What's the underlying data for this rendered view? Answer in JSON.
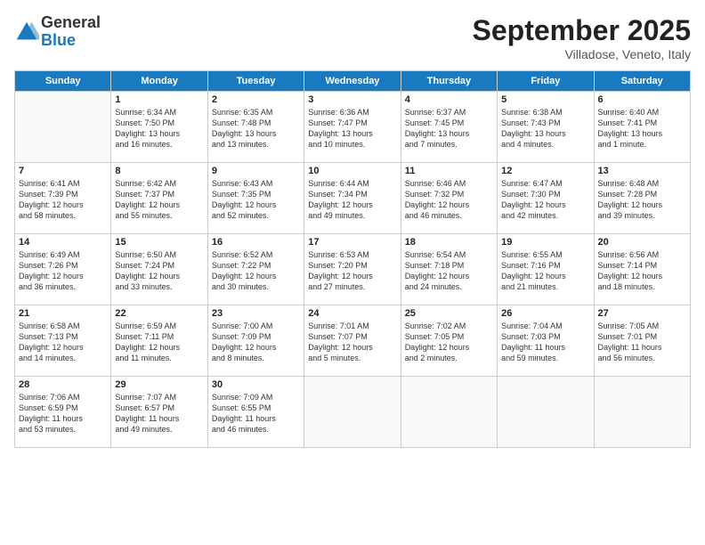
{
  "logo": {
    "general": "General",
    "blue": "Blue"
  },
  "header": {
    "month": "September 2025",
    "location": "Villadose, Veneto, Italy"
  },
  "weekdays": [
    "Sunday",
    "Monday",
    "Tuesday",
    "Wednesday",
    "Thursday",
    "Friday",
    "Saturday"
  ],
  "weeks": [
    [
      {
        "day": "",
        "info": ""
      },
      {
        "day": "1",
        "info": "Sunrise: 6:34 AM\nSunset: 7:50 PM\nDaylight: 13 hours\nand 16 minutes."
      },
      {
        "day": "2",
        "info": "Sunrise: 6:35 AM\nSunset: 7:48 PM\nDaylight: 13 hours\nand 13 minutes."
      },
      {
        "day": "3",
        "info": "Sunrise: 6:36 AM\nSunset: 7:47 PM\nDaylight: 13 hours\nand 10 minutes."
      },
      {
        "day": "4",
        "info": "Sunrise: 6:37 AM\nSunset: 7:45 PM\nDaylight: 13 hours\nand 7 minutes."
      },
      {
        "day": "5",
        "info": "Sunrise: 6:38 AM\nSunset: 7:43 PM\nDaylight: 13 hours\nand 4 minutes."
      },
      {
        "day": "6",
        "info": "Sunrise: 6:40 AM\nSunset: 7:41 PM\nDaylight: 13 hours\nand 1 minute."
      }
    ],
    [
      {
        "day": "7",
        "info": "Sunrise: 6:41 AM\nSunset: 7:39 PM\nDaylight: 12 hours\nand 58 minutes."
      },
      {
        "day": "8",
        "info": "Sunrise: 6:42 AM\nSunset: 7:37 PM\nDaylight: 12 hours\nand 55 minutes."
      },
      {
        "day": "9",
        "info": "Sunrise: 6:43 AM\nSunset: 7:35 PM\nDaylight: 12 hours\nand 52 minutes."
      },
      {
        "day": "10",
        "info": "Sunrise: 6:44 AM\nSunset: 7:34 PM\nDaylight: 12 hours\nand 49 minutes."
      },
      {
        "day": "11",
        "info": "Sunrise: 6:46 AM\nSunset: 7:32 PM\nDaylight: 12 hours\nand 46 minutes."
      },
      {
        "day": "12",
        "info": "Sunrise: 6:47 AM\nSunset: 7:30 PM\nDaylight: 12 hours\nand 42 minutes."
      },
      {
        "day": "13",
        "info": "Sunrise: 6:48 AM\nSunset: 7:28 PM\nDaylight: 12 hours\nand 39 minutes."
      }
    ],
    [
      {
        "day": "14",
        "info": "Sunrise: 6:49 AM\nSunset: 7:26 PM\nDaylight: 12 hours\nand 36 minutes."
      },
      {
        "day": "15",
        "info": "Sunrise: 6:50 AM\nSunset: 7:24 PM\nDaylight: 12 hours\nand 33 minutes."
      },
      {
        "day": "16",
        "info": "Sunrise: 6:52 AM\nSunset: 7:22 PM\nDaylight: 12 hours\nand 30 minutes."
      },
      {
        "day": "17",
        "info": "Sunrise: 6:53 AM\nSunset: 7:20 PM\nDaylight: 12 hours\nand 27 minutes."
      },
      {
        "day": "18",
        "info": "Sunrise: 6:54 AM\nSunset: 7:18 PM\nDaylight: 12 hours\nand 24 minutes."
      },
      {
        "day": "19",
        "info": "Sunrise: 6:55 AM\nSunset: 7:16 PM\nDaylight: 12 hours\nand 21 minutes."
      },
      {
        "day": "20",
        "info": "Sunrise: 6:56 AM\nSunset: 7:14 PM\nDaylight: 12 hours\nand 18 minutes."
      }
    ],
    [
      {
        "day": "21",
        "info": "Sunrise: 6:58 AM\nSunset: 7:13 PM\nDaylight: 12 hours\nand 14 minutes."
      },
      {
        "day": "22",
        "info": "Sunrise: 6:59 AM\nSunset: 7:11 PM\nDaylight: 12 hours\nand 11 minutes."
      },
      {
        "day": "23",
        "info": "Sunrise: 7:00 AM\nSunset: 7:09 PM\nDaylight: 12 hours\nand 8 minutes."
      },
      {
        "day": "24",
        "info": "Sunrise: 7:01 AM\nSunset: 7:07 PM\nDaylight: 12 hours\nand 5 minutes."
      },
      {
        "day": "25",
        "info": "Sunrise: 7:02 AM\nSunset: 7:05 PM\nDaylight: 12 hours\nand 2 minutes."
      },
      {
        "day": "26",
        "info": "Sunrise: 7:04 AM\nSunset: 7:03 PM\nDaylight: 11 hours\nand 59 minutes."
      },
      {
        "day": "27",
        "info": "Sunrise: 7:05 AM\nSunset: 7:01 PM\nDaylight: 11 hours\nand 56 minutes."
      }
    ],
    [
      {
        "day": "28",
        "info": "Sunrise: 7:06 AM\nSunset: 6:59 PM\nDaylight: 11 hours\nand 53 minutes."
      },
      {
        "day": "29",
        "info": "Sunrise: 7:07 AM\nSunset: 6:57 PM\nDaylight: 11 hours\nand 49 minutes."
      },
      {
        "day": "30",
        "info": "Sunrise: 7:09 AM\nSunset: 6:55 PM\nDaylight: 11 hours\nand 46 minutes."
      },
      {
        "day": "",
        "info": ""
      },
      {
        "day": "",
        "info": ""
      },
      {
        "day": "",
        "info": ""
      },
      {
        "day": "",
        "info": ""
      }
    ]
  ]
}
